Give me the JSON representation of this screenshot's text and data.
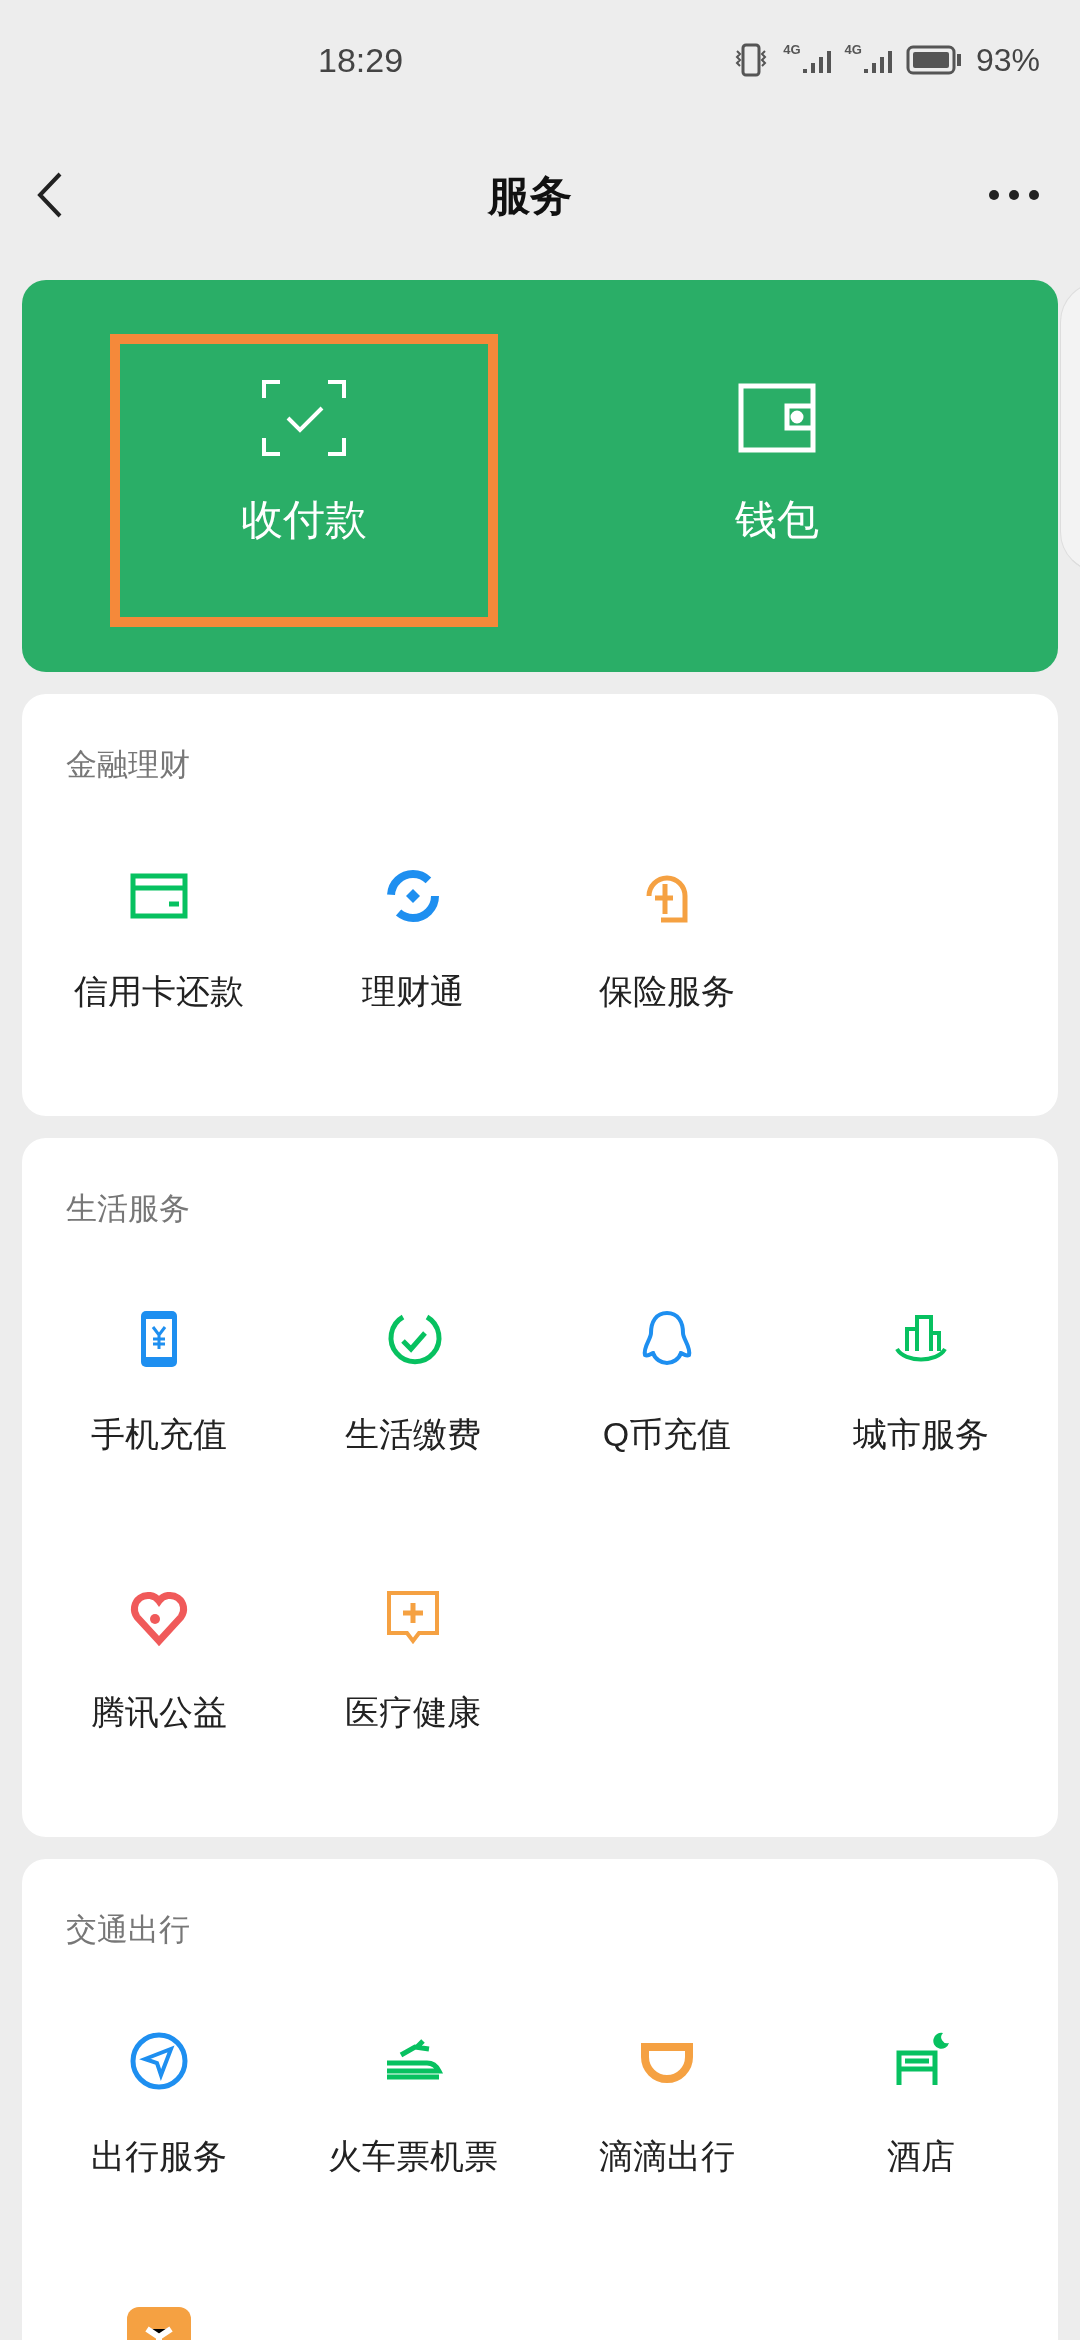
{
  "status_bar": {
    "time": "18:29",
    "networks": [
      "4G",
      "4G"
    ],
    "battery": "93%"
  },
  "nav": {
    "title": "服务"
  },
  "wallet_card": {
    "items": [
      {
        "label": "收付款",
        "highlighted": true
      },
      {
        "label": "钱包",
        "highlighted": false
      }
    ]
  },
  "sections": [
    {
      "title": "金融理财",
      "items": [
        {
          "label": "信用卡还款"
        },
        {
          "label": "理财通"
        },
        {
          "label": "保险服务"
        }
      ]
    },
    {
      "title": "生活服务",
      "items": [
        {
          "label": "手机充值"
        },
        {
          "label": "生活缴费"
        },
        {
          "label": "Q币充值"
        },
        {
          "label": "城市服务"
        },
        {
          "label": "腾讯公益"
        },
        {
          "label": "医疗健康"
        }
      ]
    },
    {
      "title": "交通出行",
      "items": [
        {
          "label": "出行服务"
        },
        {
          "label": "火车票机票"
        },
        {
          "label": "滴滴出行"
        },
        {
          "label": "酒店"
        }
      ]
    }
  ]
}
